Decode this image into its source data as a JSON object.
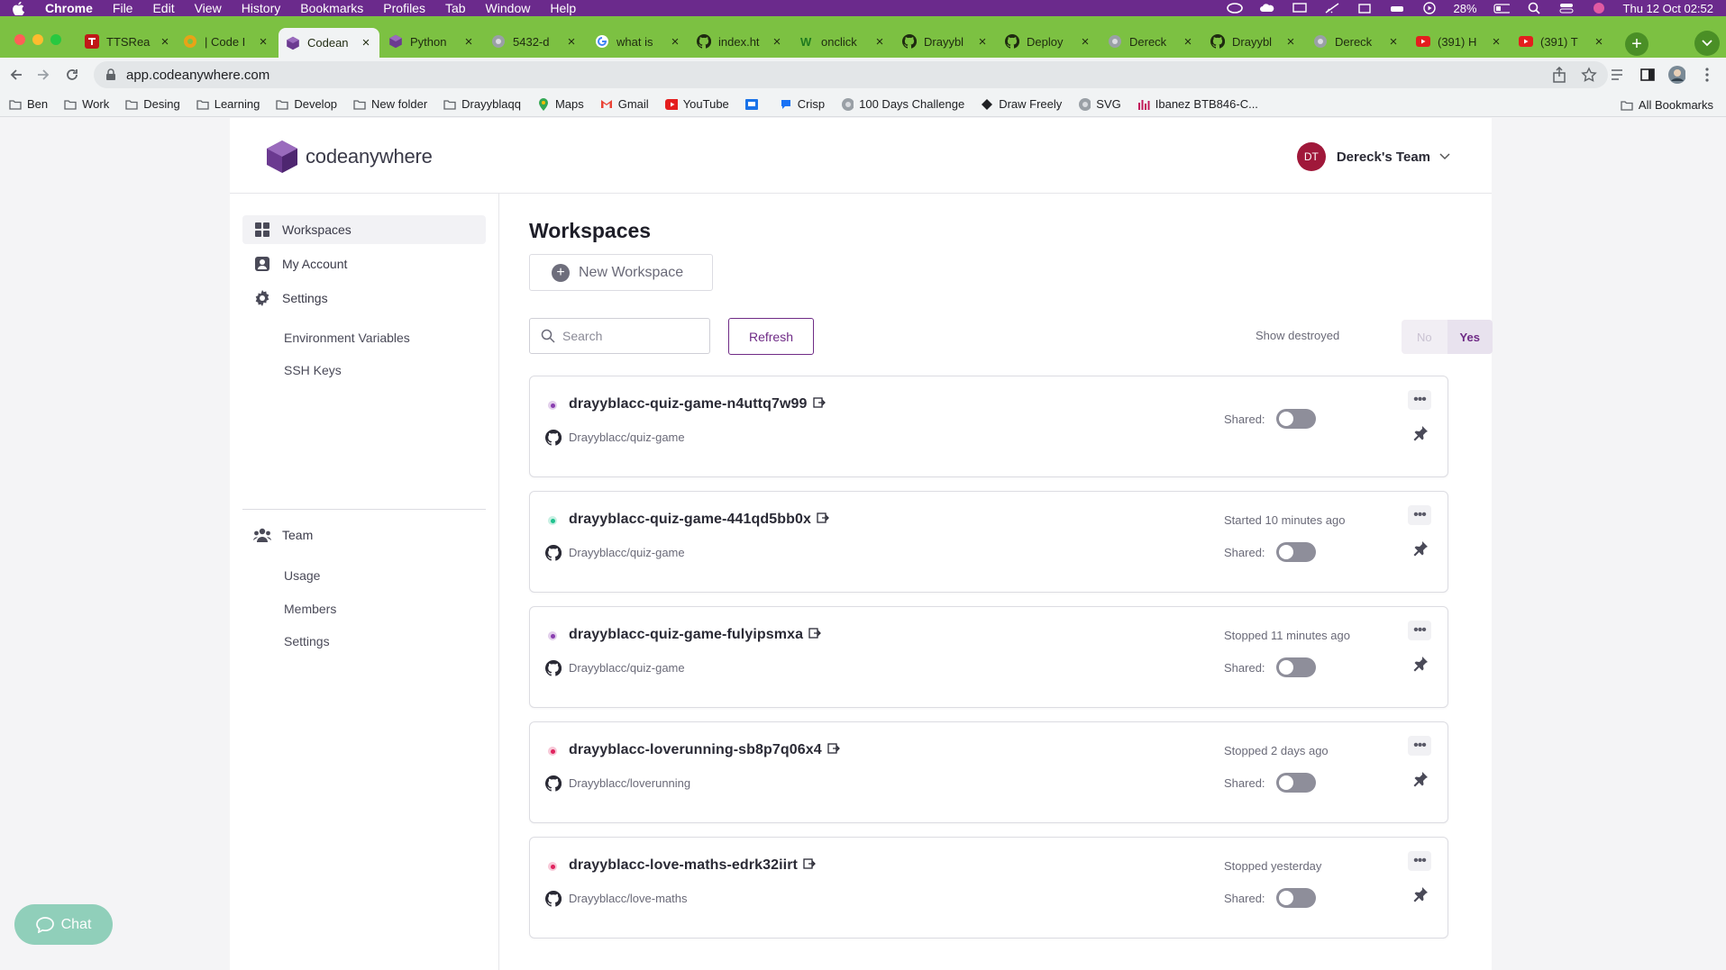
{
  "menubar": {
    "app": "Chrome",
    "items": [
      "File",
      "Edit",
      "View",
      "History",
      "Bookmarks",
      "Profiles",
      "Tab",
      "Window",
      "Help"
    ],
    "battery": "28%",
    "datetime": "Thu 12 Oct  02:52"
  },
  "tabs": [
    {
      "title": "TTSRea",
      "icon": "tts-icon",
      "active": false
    },
    {
      "title": "| Code I",
      "icon": "code-icon",
      "active": false
    },
    {
      "title": "Codean",
      "icon": "codeanywhere-icon",
      "active": true
    },
    {
      "title": "Python",
      "icon": "codeanywhere-icon",
      "active": false
    },
    {
      "title": "5432-d",
      "icon": "globe-icon",
      "active": false
    },
    {
      "title": "what is",
      "icon": "google-icon",
      "active": false
    },
    {
      "title": "index.ht",
      "icon": "github-icon",
      "active": false
    },
    {
      "title": "onclick",
      "icon": "w3-icon",
      "active": false
    },
    {
      "title": "Drayybl",
      "icon": "github-icon",
      "active": false
    },
    {
      "title": "Deploy",
      "icon": "github-icon",
      "active": false
    },
    {
      "title": "Dereck",
      "icon": "globe-icon",
      "active": false
    },
    {
      "title": "Drayybl",
      "icon": "github-icon",
      "active": false
    },
    {
      "title": "Dereck",
      "icon": "globe-icon",
      "active": false
    },
    {
      "title": "(391) H",
      "icon": "youtube-icon",
      "active": false
    },
    {
      "title": "(391) T",
      "icon": "youtube-icon",
      "active": false
    }
  ],
  "address": {
    "url": "app.codeanywhere.com"
  },
  "bookmarks": [
    {
      "label": "Ben",
      "icon": "folder-icon"
    },
    {
      "label": "Work",
      "icon": "folder-icon"
    },
    {
      "label": "Desing",
      "icon": "folder-icon"
    },
    {
      "label": "Learning",
      "icon": "folder-icon"
    },
    {
      "label": "Develop",
      "icon": "folder-icon"
    },
    {
      "label": "New folder",
      "icon": "folder-icon"
    },
    {
      "label": "Drayyblaqq",
      "icon": "folder-icon"
    },
    {
      "label": "Maps",
      "icon": "maps-icon"
    },
    {
      "label": "Gmail",
      "icon": "gmail-icon"
    },
    {
      "label": "YouTube",
      "icon": "youtube-icon"
    },
    {
      "label": "",
      "icon": "app-icon"
    },
    {
      "label": "Crisp",
      "icon": "crisp-icon"
    },
    {
      "label": "100 Days Challenge",
      "icon": "globe-icon"
    },
    {
      "label": "Draw Freely",
      "icon": "draw-icon"
    },
    {
      "label": "SVG",
      "icon": "globe-icon"
    },
    {
      "label": "Ibanez BTB846-C...",
      "icon": "chart-icon"
    }
  ],
  "all_bookmarks": "All Bookmarks",
  "app": {
    "brand": "codeanywhere",
    "team": {
      "initials": "DT",
      "name": "Dereck's Team"
    },
    "sidebar": {
      "workspaces": "Workspaces",
      "my_account": "My Account",
      "settings": "Settings",
      "env_vars": "Environment Variables",
      "ssh_keys": "SSH Keys",
      "team": "Team",
      "usage": "Usage",
      "members": "Members",
      "team_settings": "Settings"
    },
    "main": {
      "title": "Workspaces",
      "new_workspace": "New Workspace",
      "search_placeholder": "Search",
      "refresh": "Refresh",
      "show_destroyed": "Show destroyed",
      "toggle_no": "No",
      "toggle_yes": "Yes",
      "shared_label": "Shared:"
    },
    "workspaces": [
      {
        "name": "drayyblacc-quiz-game-n4uttq7w99",
        "repo": "Drayyblacc/quiz-game",
        "status": "",
        "state_color": "#8a3fb0",
        "shared": false
      },
      {
        "name": "drayyblacc-quiz-game-441qd5bb0x",
        "repo": "Drayyblacc/quiz-game",
        "status": "Started 10 minutes ago",
        "state_color": "#21c28e",
        "shared": false
      },
      {
        "name": "drayyblacc-quiz-game-fulyipsmxa",
        "repo": "Drayyblacc/quiz-game",
        "status": "Stopped 11 minutes ago",
        "state_color": "#8a3fb0",
        "shared": false
      },
      {
        "name": "drayyblacc-loverunning-sb8p7q06x4",
        "repo": "Drayyblacc/loverunning",
        "status": "Stopped 2 days ago",
        "state_color": "#e0245e",
        "shared": false
      },
      {
        "name": "drayyblacc-love-maths-edrk32iirt",
        "repo": "Drayyblacc/love-maths",
        "status": "Stopped yesterday",
        "state_color": "#e0245e",
        "shared": false
      }
    ],
    "chat": "Chat"
  },
  "colors": {
    "accent": "#6f2b86",
    "tabstrip": "#7cc142",
    "menubar": "#6b2a8c"
  }
}
